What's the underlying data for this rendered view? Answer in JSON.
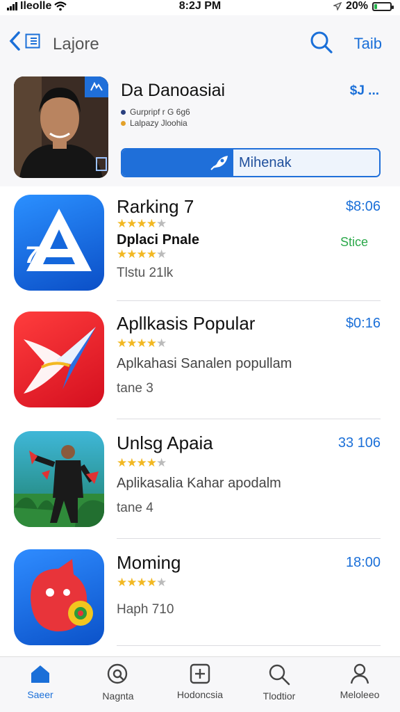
{
  "status_bar": {
    "carrier": "Ileolle",
    "time": "8:2J PM",
    "battery": "20%",
    "battery_level": 0.2
  },
  "nav": {
    "back_label": "",
    "title": "Lajore",
    "action_label": "Taib"
  },
  "featured": {
    "name": "Da Danoasiai",
    "price": "$J ...",
    "meta_line1": "Gurpripf r G 6g6",
    "meta_line2": "Lalpazy Jloohia",
    "button_label": "Mihenak",
    "colors": {
      "accent": "#1f6fd9"
    }
  },
  "apps": [
    {
      "name": "Rarking 7",
      "price": "$8:06",
      "rating": 4,
      "subtitle": "Dplaci Pnale",
      "tag": "Stice",
      "sub_rating": 4,
      "extra": "Tlstu 21lk"
    },
    {
      "name": "Apllkasis Popular",
      "price": "$0:16",
      "rating": 4,
      "description": "Aplkahasi Sanalen popullam",
      "extra": "tane 3"
    },
    {
      "name": "Unlsg Apaia",
      "price": "33 106",
      "rating": 4,
      "description": "Aplikasalia Kahar apodalm",
      "extra": "tane 4"
    },
    {
      "name": "Moming",
      "price": "18:00",
      "rating": 4,
      "extra": "Haph 710"
    }
  ],
  "tabs": [
    {
      "label": "Saeer",
      "icon": "home-icon",
      "active": true
    },
    {
      "label": "Nagnta",
      "icon": "magnify-search-icon",
      "active": false
    },
    {
      "label": "Hodoncsia",
      "icon": "plus-square-icon",
      "active": false
    },
    {
      "label": "Tlodtior",
      "icon": "search-icon",
      "active": false
    },
    {
      "label": "Meloleeo",
      "icon": "person-icon",
      "active": false
    }
  ]
}
